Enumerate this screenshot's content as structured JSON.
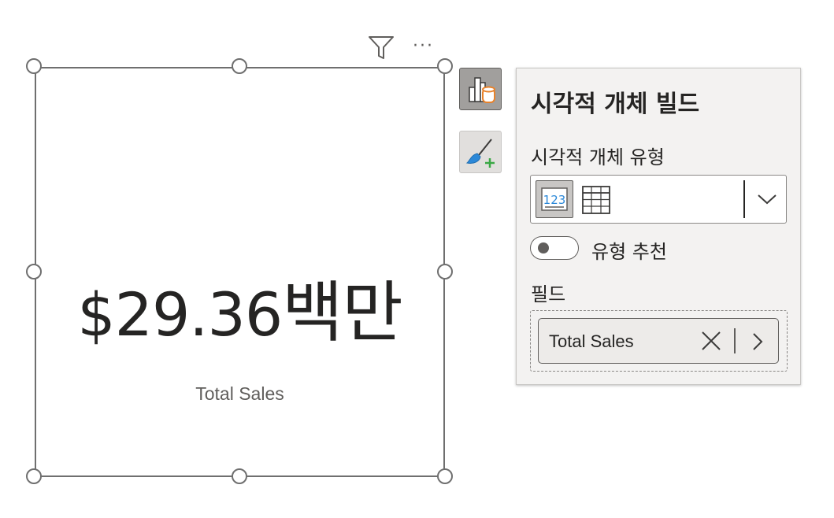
{
  "visual": {
    "value_number": "$29.36",
    "value_unit": "백만",
    "label": "Total Sales",
    "header_icons": [
      "filter-icon",
      "more-options-icon"
    ],
    "more_label": "···"
  },
  "side_buttons": [
    {
      "name": "build-visual",
      "icon": "build-visual-icon",
      "active": true
    },
    {
      "name": "format-visual",
      "icon": "format-brush-icon",
      "active": false
    }
  ],
  "pane": {
    "title": "시각적 개체 빌드",
    "visual_type_label": "시각적 개체 유형",
    "visual_types": [
      {
        "name": "card",
        "icon": "card-123-icon",
        "selected": true
      },
      {
        "name": "table",
        "icon": "table-icon",
        "selected": false
      }
    ],
    "suggest_toggle_label": "유형 추천",
    "suggest_toggle_on": false,
    "fields_label": "필드",
    "fields": [
      {
        "name": "Total Sales"
      }
    ]
  },
  "colors": {
    "frame": "#6f6f6f",
    "text": "#252423",
    "pane_bg": "#f3f2f1",
    "accent_orange": "#e8822a",
    "accent_blue": "#2b88d8",
    "accent_green": "#3aa845"
  }
}
